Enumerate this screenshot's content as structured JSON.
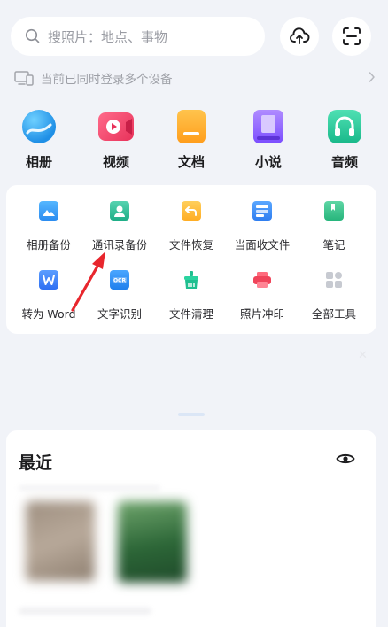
{
  "search": {
    "placeholder": "搜照片：地点、事物"
  },
  "devices": {
    "text": "当前已同时登录多个设备"
  },
  "categories": [
    {
      "label": "相册"
    },
    {
      "label": "视频"
    },
    {
      "label": "文档"
    },
    {
      "label": "小说"
    },
    {
      "label": "音频"
    }
  ],
  "tools": [
    {
      "label": "相册备份"
    },
    {
      "label": "通讯录备份"
    },
    {
      "label": "文件恢复"
    },
    {
      "label": "当面收文件"
    },
    {
      "label": "笔记"
    },
    {
      "label": "转为 Word"
    },
    {
      "label": "文字识别"
    },
    {
      "label": "文件清理"
    },
    {
      "label": "照片冲印"
    },
    {
      "label": "全部工具"
    }
  ],
  "recent": {
    "title": "最近"
  },
  "colors": {
    "annotation_arrow": "#e8262d",
    "background": "#f1f3f8"
  }
}
